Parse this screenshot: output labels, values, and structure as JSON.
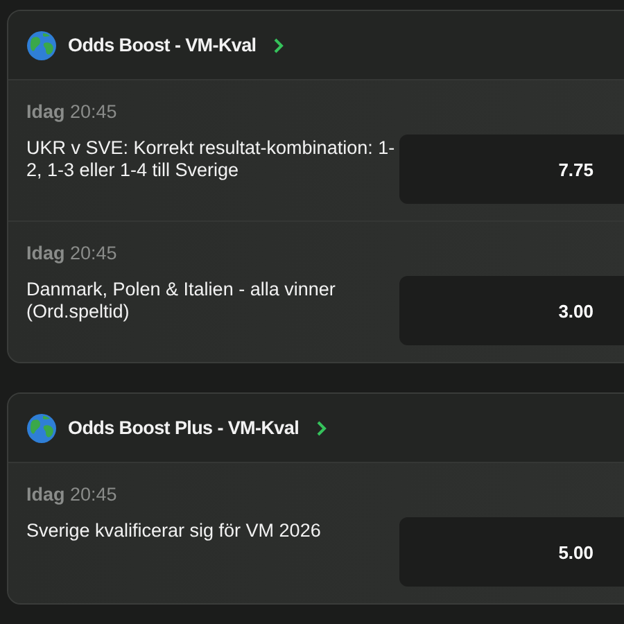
{
  "sections": [
    {
      "title": "Odds Boost - VM-Kval",
      "bets": [
        {
          "day": "Idag",
          "time": "20:45",
          "description": "UKR v SVE: Korrekt resultat-kombination: 1-2, 1-3 eller 1-4 till Sverige",
          "odds": "7.75"
        },
        {
          "day": "Idag",
          "time": "20:45",
          "description": "Danmark, Polen & Italien - alla vinner (Ord.speltid)",
          "odds": "3.00"
        }
      ]
    },
    {
      "title": "Odds Boost Plus - VM-Kval",
      "bets": [
        {
          "day": "Idag",
          "time": "20:45",
          "description": "Sverige kvalificerar sig för VM 2026",
          "odds": "5.00"
        }
      ]
    }
  ]
}
